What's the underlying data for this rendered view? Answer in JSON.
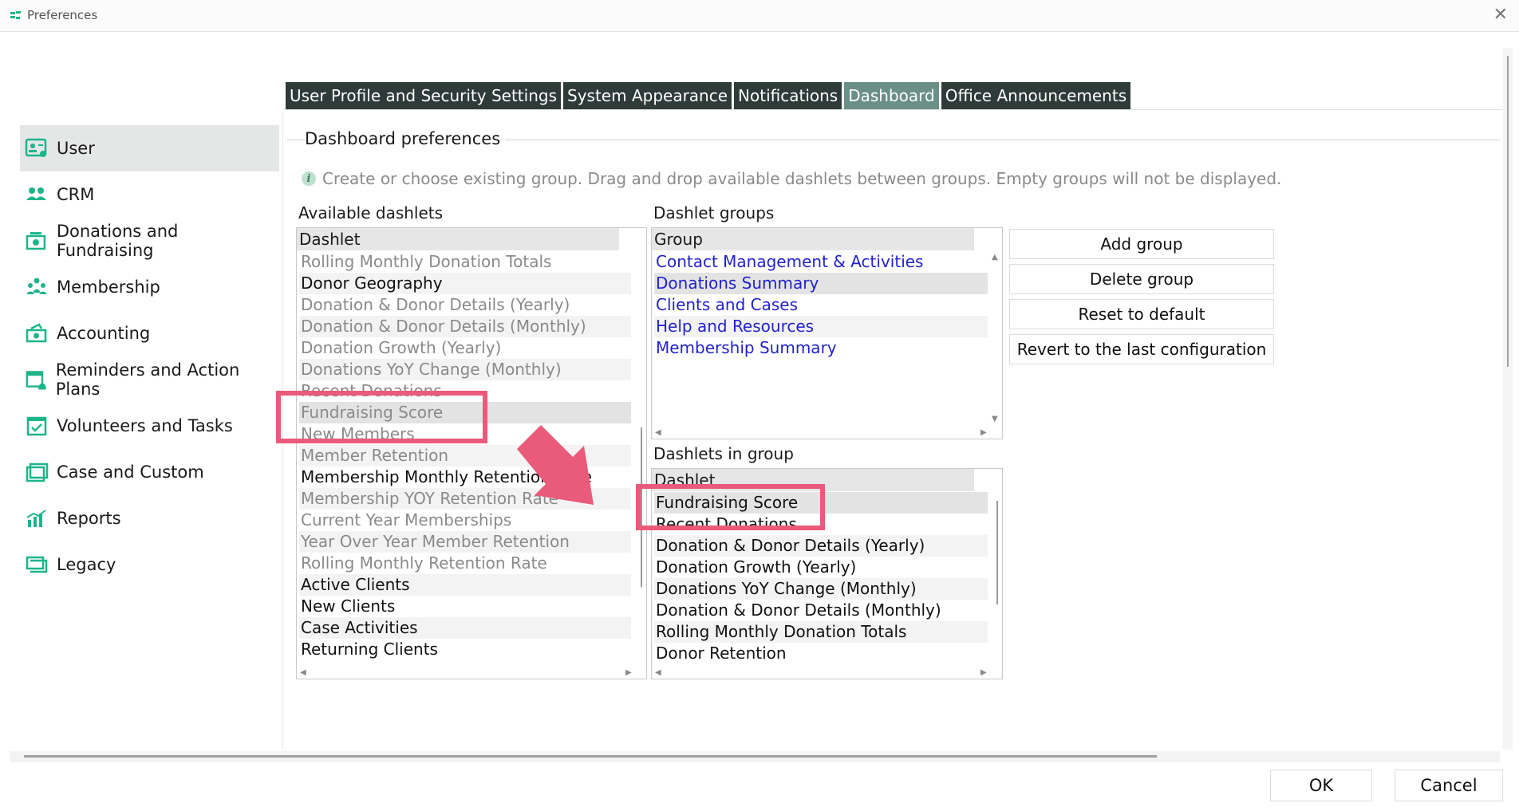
{
  "window": {
    "title": "Preferences"
  },
  "colors": {
    "tab_bg": "#2f3b39",
    "tab_active": "#6a8f86",
    "accent": "#1db58a",
    "highlight": "#ea5a7a",
    "link_blue": "#2222cc"
  },
  "sidebar": {
    "items": [
      {
        "label": "User",
        "icon": "user-card-icon",
        "active": true
      },
      {
        "label": "CRM",
        "icon": "people-icon"
      },
      {
        "label": "Donations and Fundraising",
        "icon": "donation-box-icon"
      },
      {
        "label": "Membership",
        "icon": "membership-icon"
      },
      {
        "label": "Accounting",
        "icon": "money-icon"
      },
      {
        "label": "Reminders and Action Plans",
        "icon": "calendar-bell-icon"
      },
      {
        "label": "Volunteers and Tasks",
        "icon": "calendar-check-icon"
      },
      {
        "label": "Case and Custom",
        "icon": "briefcase-icon"
      },
      {
        "label": "Reports",
        "icon": "bar-chart-icon"
      },
      {
        "label": "Legacy",
        "icon": "legacy-icon"
      }
    ]
  },
  "tabs": [
    {
      "label": "User Profile and Security Settings"
    },
    {
      "label": "System Appearance"
    },
    {
      "label": "Notifications"
    },
    {
      "label": "Dashboard",
      "active": true
    },
    {
      "label": "Office Announcements"
    }
  ],
  "dashboard": {
    "legend": "Dashboard preferences",
    "info": "Create or choose existing group. Drag and drop available dashlets between groups. Empty groups will not be displayed.",
    "available_label": "Available dashlets",
    "available_header": "Dashlet",
    "available": [
      {
        "label": "Rolling Monthly Donation Totals",
        "gray": true
      },
      {
        "label": "Donor Geography"
      },
      {
        "label": "Donation & Donor Details (Yearly)",
        "gray": true
      },
      {
        "label": "Donation & Donor Details (Monthly)",
        "gray": true
      },
      {
        "label": "Donation Growth (Yearly)",
        "gray": true
      },
      {
        "label": "Donations YoY Change (Monthly)",
        "gray": true
      },
      {
        "label": "Recent Donations",
        "gray": true
      },
      {
        "label": "Fundraising Score",
        "gray": true,
        "selected": true
      },
      {
        "label": "New Members",
        "gray": true
      },
      {
        "label": "Member Retention",
        "gray": true
      },
      {
        "label": "Membership Monthly Retention Rate"
      },
      {
        "label": "Membership YOY Retention Rate",
        "gray": true
      },
      {
        "label": "Current Year Memberships",
        "gray": true
      },
      {
        "label": "Year Over Year Member Retention",
        "gray": true
      },
      {
        "label": "Rolling Monthly Retention Rate",
        "gray": true
      },
      {
        "label": "Active Clients"
      },
      {
        "label": "New Clients"
      },
      {
        "label": "Case Activities"
      },
      {
        "label": "Returning Clients"
      }
    ],
    "groups_label": "Dashlet groups",
    "groups_header": "Group",
    "groups": [
      {
        "label": "Contact Management & Activities"
      },
      {
        "label": "Donations Summary",
        "selected": true
      },
      {
        "label": "Clients and Cases"
      },
      {
        "label": "Help and Resources"
      },
      {
        "label": "Membership Summary"
      }
    ],
    "in_group_label": "Dashlets in group",
    "in_group_header": "Dashlet",
    "in_group": [
      {
        "label": "Fundraising Score",
        "selected": true
      },
      {
        "label": "Recent Donations"
      },
      {
        "label": "Donation & Donor Details (Yearly)"
      },
      {
        "label": "Donation Growth (Yearly)"
      },
      {
        "label": "Donations YoY Change (Monthly)"
      },
      {
        "label": "Donation & Donor Details (Monthly)"
      },
      {
        "label": "Rolling Monthly Donation Totals"
      },
      {
        "label": "Donor Retention"
      }
    ],
    "buttons": {
      "add_group": "Add group",
      "delete_group": "Delete group",
      "reset": "Reset to default",
      "revert": "Revert to the last configuration"
    }
  },
  "footer": {
    "ok": "OK",
    "cancel": "Cancel"
  }
}
